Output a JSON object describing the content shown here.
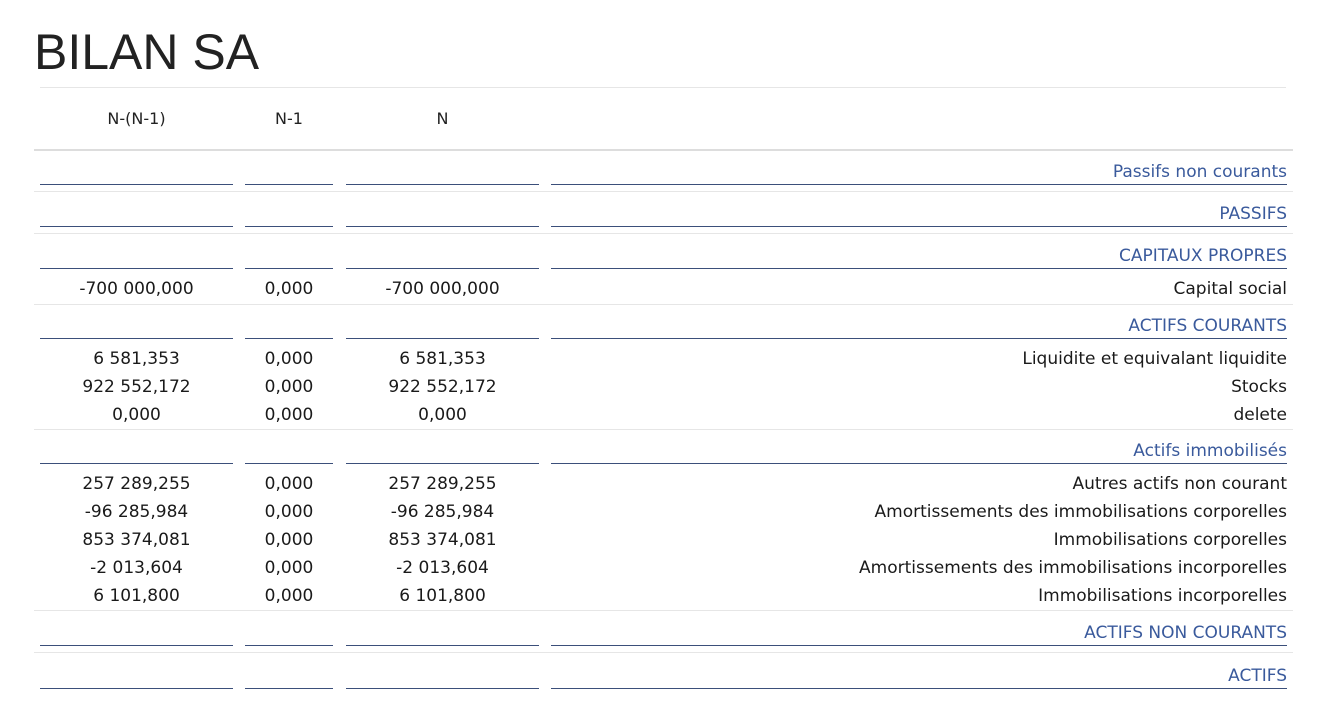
{
  "title": "BILAN SA",
  "header": {
    "col1": "N-(N-1)",
    "col2": "N-1",
    "col3": "N"
  },
  "rows": [
    {
      "type": "section",
      "label": "Passifs non courants"
    },
    {
      "type": "section",
      "label": "PASSIFS"
    },
    {
      "type": "section",
      "label": "CAPITAUX PROPRES"
    },
    {
      "type": "item",
      "v1": "-700 000,000",
      "v2": "0,000",
      "v3": "-700 000,000",
      "label": "Capital social"
    },
    {
      "type": "section",
      "label": "ACTIFS COURANTS"
    },
    {
      "type": "item",
      "v1": "6 581,353",
      "v2": "0,000",
      "v3": "6 581,353",
      "label": "Liquidite et equivalant liquidite"
    },
    {
      "type": "item",
      "v1": "922 552,172",
      "v2": "0,000",
      "v3": "922 552,172",
      "label": "Stocks"
    },
    {
      "type": "item",
      "v1": "0,000",
      "v2": "0,000",
      "v3": "0,000",
      "label": "delete"
    },
    {
      "type": "section",
      "label": "Actifs immobilisés"
    },
    {
      "type": "item",
      "v1": "257 289,255",
      "v2": "0,000",
      "v3": "257 289,255",
      "label": "Autres actifs non courant"
    },
    {
      "type": "item",
      "v1": "-96 285,984",
      "v2": "0,000",
      "v3": "-96 285,984",
      "label": "Amortissements des immobilisations corporelles"
    },
    {
      "type": "item",
      "v1": "853 374,081",
      "v2": "0,000",
      "v3": "853 374,081",
      "label": "Immobilisations corporelles"
    },
    {
      "type": "item",
      "v1": "-2 013,604",
      "v2": "0,000",
      "v3": "-2 013,604",
      "label": "Amortissements des immobilisations incorporelles"
    },
    {
      "type": "item",
      "v1": "6 101,800",
      "v2": "0,000",
      "v3": "6 101,800",
      "label": "Immobilisations incorporelles"
    },
    {
      "type": "section",
      "label": "ACTIFS NON COURANTS"
    },
    {
      "type": "section",
      "label": "ACTIFS"
    }
  ]
}
